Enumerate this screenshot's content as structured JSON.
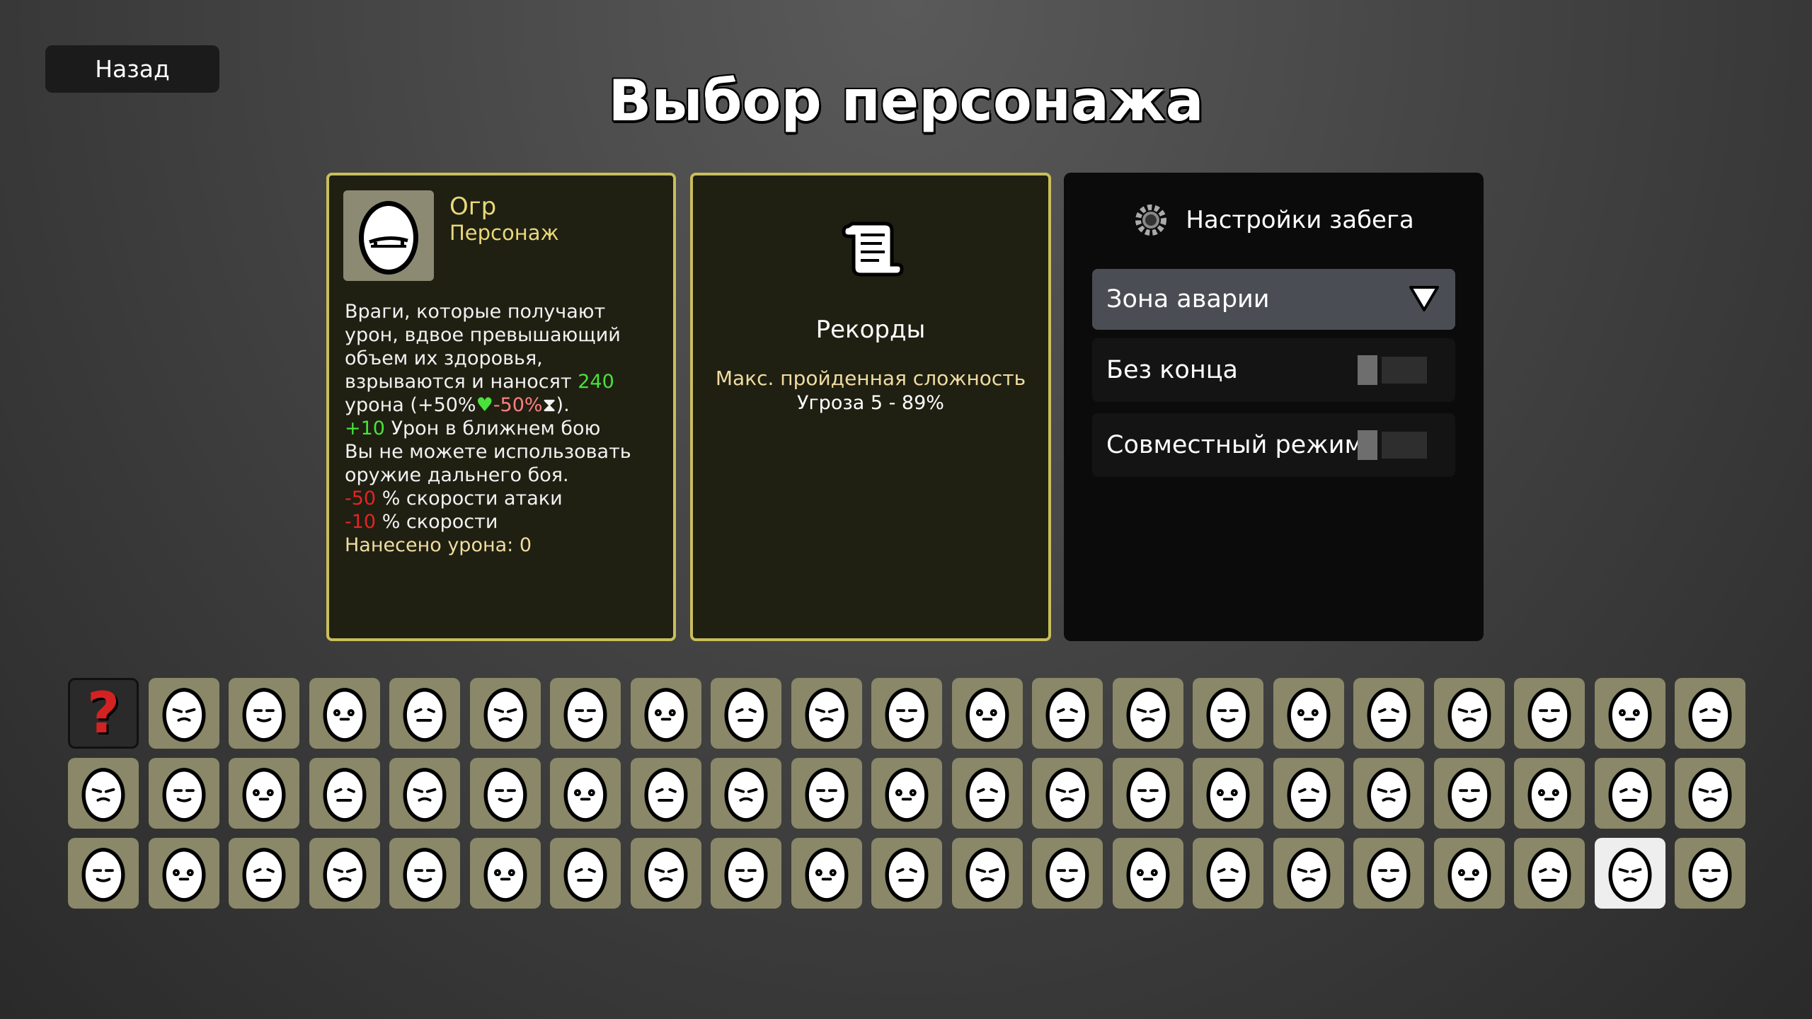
{
  "header": {
    "back_label": "Назад",
    "title": "Выбор персонажа"
  },
  "character": {
    "name": "Огр",
    "type": "Персонаж",
    "portrait_icon": "ogre-egg-icon",
    "description": {
      "l1": "Враги, которые получают",
      "l2": "урон, вдвое превышающий",
      "l3": "объем их здоровья,",
      "l4a": "взрываются и наносят ",
      "l4b": "240",
      "l5a": "урона (",
      "l5b": "+50%",
      "l5c": "-50%",
      "l5d": ").",
      "l6a": "+10",
      "l6b": " Урон в ближнем бою",
      "l7": "Вы не можете использовать",
      "l8": "оружие дальнего боя.",
      "l9a": "-50",
      "l9b": " % скорости атаки",
      "l10a": "-10",
      "l10b": " % скорости",
      "l11": "Нанесено урона: 0"
    }
  },
  "records": {
    "icon": "scroll-icon",
    "title": "Рекорды",
    "label": "Макс. пройденная сложность",
    "value": "Угроза 5 - 89%"
  },
  "run_settings": {
    "icon": "gear-icon",
    "title": "Настройки забега",
    "zone": "Зона аварии",
    "endless_label": "Без конца",
    "endless_on": false,
    "coop_label": "Совместный режим",
    "coop_on": false
  },
  "character_grid": {
    "rows": 3,
    "columns": 21,
    "first_cell": "random-character",
    "selected_index": 61,
    "colors": {
      "cell": "#8a8868",
      "selected_cell": "#eeeeee",
      "random_cell": "#2a2a2a"
    }
  },
  "colors": {
    "accent_gold": "#c9be5a",
    "positive": "#49e23a",
    "negative": "#e42424"
  }
}
